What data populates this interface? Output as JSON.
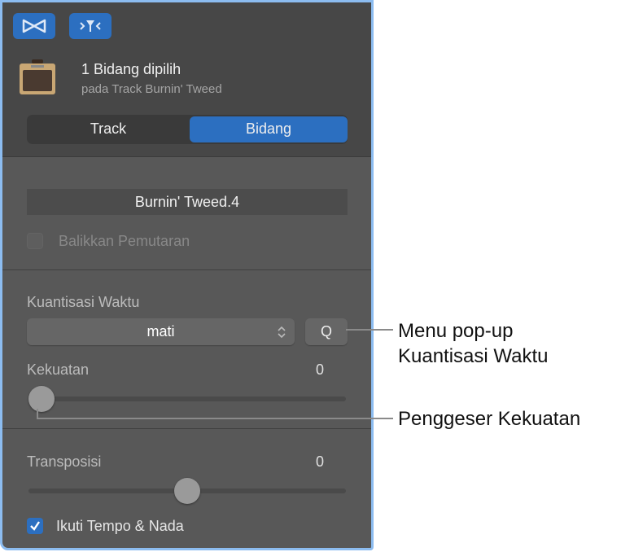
{
  "header": {
    "title": "1 Bidang dipilih",
    "subtitle": "pada Track Burnin' Tweed"
  },
  "tabs": [
    {
      "label": "Track",
      "active": false
    },
    {
      "label": "Bidang",
      "active": true
    }
  ],
  "region": {
    "name": "Burnin' Tweed.4",
    "reverse_label": "Balikkan Pemutaran",
    "reverse_checked": false
  },
  "quantize": {
    "label": "Kuantisasi Waktu",
    "value": "mati",
    "q_button": "Q"
  },
  "strength": {
    "label": "Kekuatan",
    "value": "0",
    "fraction": 0
  },
  "transpose": {
    "label": "Transposisi",
    "value": "0",
    "fraction": 0.5
  },
  "follow": {
    "label": "Ikuti Tempo & Nada",
    "checked": true
  },
  "callouts": {
    "quantize_line1": "Menu pop-up",
    "quantize_line2": "Kuantisasi Waktu",
    "strength": "Penggeser Kekuatan"
  },
  "colors": {
    "accent": "#2c6fc0",
    "panel": "#585858"
  }
}
